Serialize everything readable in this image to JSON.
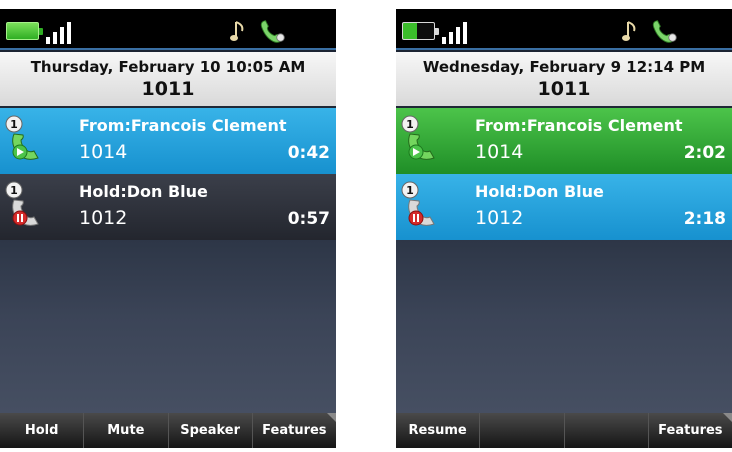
{
  "phones": [
    {
      "date": "Thursday, February 10 10:05 AM",
      "extension": "1011",
      "calls": [
        {
          "badge": "1",
          "title": "From:Francois Clement",
          "number": "1014",
          "duration": "0:42",
          "state": "active"
        },
        {
          "badge": "1",
          "title": "Hold:Don Blue",
          "number": "1012",
          "duration": "0:57",
          "state": "hold"
        }
      ],
      "softkeys": [
        "Hold",
        "Mute",
        "Speaker",
        "Features"
      ]
    },
    {
      "date": "Wednesday, February 9 12:14 PM",
      "extension": "1011",
      "calls": [
        {
          "badge": "1",
          "title": "From:Francois Clement",
          "number": "1014",
          "duration": "2:02",
          "state": "active"
        },
        {
          "badge": "1",
          "title": "Hold:Don Blue",
          "number": "1012",
          "duration": "2:18",
          "state": "hold"
        }
      ],
      "softkeys": [
        "Resume",
        "",
        "",
        "Features"
      ]
    }
  ],
  "colors": {
    "selected_call": "#1791cf",
    "active_green": "#1f8e27",
    "dark_call": "#23262e",
    "accent_line": "#3a6fa3"
  },
  "icons": {
    "battery": "battery-icon",
    "signal": "signal-icon",
    "ringtone": "music-note-icon",
    "line": "handset-icon",
    "active_call": "call-active-icon",
    "held_call": "call-hold-icon"
  }
}
